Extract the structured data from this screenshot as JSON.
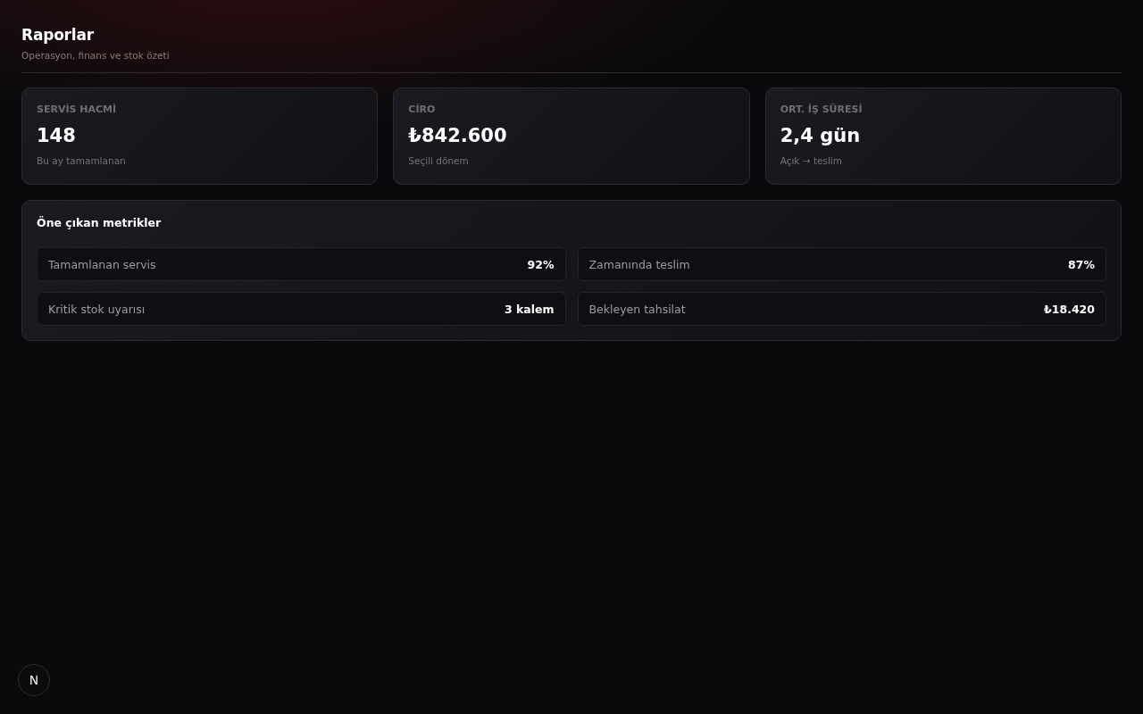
{
  "header": {
    "title": "Raporlar",
    "subtitle": "Operasyon, finans ve stok özeti"
  },
  "stat_cards": [
    {
      "label": "SERVİS HACMİ",
      "value": "148",
      "note": "Bu ay tamamlanan"
    },
    {
      "label": "CİRO",
      "value": "₺842.600",
      "note": "Seçili dönem"
    },
    {
      "label": "ORT. İŞ SÜRESİ",
      "value": "2,4 gün",
      "note": "Açık → teslim"
    }
  ],
  "highlights": {
    "title": "Öne çıkan metrikler",
    "items": [
      {
        "label": "Tamamlanan servis",
        "value": "92%"
      },
      {
        "label": "Zamanında teslim",
        "value": "87%"
      },
      {
        "label": "Kritik stok uyarısı",
        "value": "3 kalem"
      },
      {
        "label": "Bekleyen tahsilat",
        "value": "₺18.420"
      }
    ]
  },
  "dev_indicator": {
    "label": "N"
  }
}
